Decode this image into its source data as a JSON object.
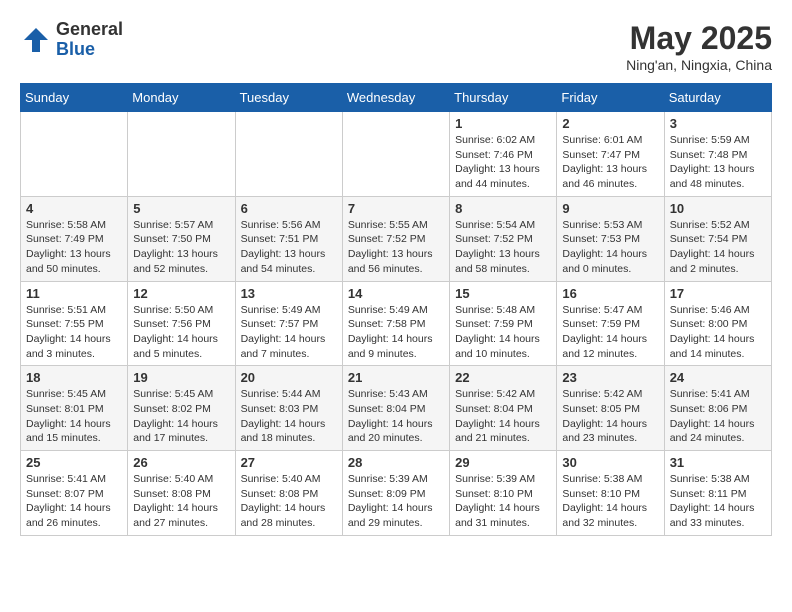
{
  "logo": {
    "general": "General",
    "blue": "Blue"
  },
  "title": "May 2025",
  "subtitle": "Ning'an, Ningxia, China",
  "days_of_week": [
    "Sunday",
    "Monday",
    "Tuesday",
    "Wednesday",
    "Thursday",
    "Friday",
    "Saturday"
  ],
  "weeks": [
    [
      {
        "day": "",
        "info": ""
      },
      {
        "day": "",
        "info": ""
      },
      {
        "day": "",
        "info": ""
      },
      {
        "day": "",
        "info": ""
      },
      {
        "day": "1",
        "info": "Sunrise: 6:02 AM\nSunset: 7:46 PM\nDaylight: 13 hours\nand 44 minutes."
      },
      {
        "day": "2",
        "info": "Sunrise: 6:01 AM\nSunset: 7:47 PM\nDaylight: 13 hours\nand 46 minutes."
      },
      {
        "day": "3",
        "info": "Sunrise: 5:59 AM\nSunset: 7:48 PM\nDaylight: 13 hours\nand 48 minutes."
      }
    ],
    [
      {
        "day": "4",
        "info": "Sunrise: 5:58 AM\nSunset: 7:49 PM\nDaylight: 13 hours\nand 50 minutes."
      },
      {
        "day": "5",
        "info": "Sunrise: 5:57 AM\nSunset: 7:50 PM\nDaylight: 13 hours\nand 52 minutes."
      },
      {
        "day": "6",
        "info": "Sunrise: 5:56 AM\nSunset: 7:51 PM\nDaylight: 13 hours\nand 54 minutes."
      },
      {
        "day": "7",
        "info": "Sunrise: 5:55 AM\nSunset: 7:52 PM\nDaylight: 13 hours\nand 56 minutes."
      },
      {
        "day": "8",
        "info": "Sunrise: 5:54 AM\nSunset: 7:52 PM\nDaylight: 13 hours\nand 58 minutes."
      },
      {
        "day": "9",
        "info": "Sunrise: 5:53 AM\nSunset: 7:53 PM\nDaylight: 14 hours\nand 0 minutes."
      },
      {
        "day": "10",
        "info": "Sunrise: 5:52 AM\nSunset: 7:54 PM\nDaylight: 14 hours\nand 2 minutes."
      }
    ],
    [
      {
        "day": "11",
        "info": "Sunrise: 5:51 AM\nSunset: 7:55 PM\nDaylight: 14 hours\nand 3 minutes."
      },
      {
        "day": "12",
        "info": "Sunrise: 5:50 AM\nSunset: 7:56 PM\nDaylight: 14 hours\nand 5 minutes."
      },
      {
        "day": "13",
        "info": "Sunrise: 5:49 AM\nSunset: 7:57 PM\nDaylight: 14 hours\nand 7 minutes."
      },
      {
        "day": "14",
        "info": "Sunrise: 5:49 AM\nSunset: 7:58 PM\nDaylight: 14 hours\nand 9 minutes."
      },
      {
        "day": "15",
        "info": "Sunrise: 5:48 AM\nSunset: 7:59 PM\nDaylight: 14 hours\nand 10 minutes."
      },
      {
        "day": "16",
        "info": "Sunrise: 5:47 AM\nSunset: 7:59 PM\nDaylight: 14 hours\nand 12 minutes."
      },
      {
        "day": "17",
        "info": "Sunrise: 5:46 AM\nSunset: 8:00 PM\nDaylight: 14 hours\nand 14 minutes."
      }
    ],
    [
      {
        "day": "18",
        "info": "Sunrise: 5:45 AM\nSunset: 8:01 PM\nDaylight: 14 hours\nand 15 minutes."
      },
      {
        "day": "19",
        "info": "Sunrise: 5:45 AM\nSunset: 8:02 PM\nDaylight: 14 hours\nand 17 minutes."
      },
      {
        "day": "20",
        "info": "Sunrise: 5:44 AM\nSunset: 8:03 PM\nDaylight: 14 hours\nand 18 minutes."
      },
      {
        "day": "21",
        "info": "Sunrise: 5:43 AM\nSunset: 8:04 PM\nDaylight: 14 hours\nand 20 minutes."
      },
      {
        "day": "22",
        "info": "Sunrise: 5:42 AM\nSunset: 8:04 PM\nDaylight: 14 hours\nand 21 minutes."
      },
      {
        "day": "23",
        "info": "Sunrise: 5:42 AM\nSunset: 8:05 PM\nDaylight: 14 hours\nand 23 minutes."
      },
      {
        "day": "24",
        "info": "Sunrise: 5:41 AM\nSunset: 8:06 PM\nDaylight: 14 hours\nand 24 minutes."
      }
    ],
    [
      {
        "day": "25",
        "info": "Sunrise: 5:41 AM\nSunset: 8:07 PM\nDaylight: 14 hours\nand 26 minutes."
      },
      {
        "day": "26",
        "info": "Sunrise: 5:40 AM\nSunset: 8:08 PM\nDaylight: 14 hours\nand 27 minutes."
      },
      {
        "day": "27",
        "info": "Sunrise: 5:40 AM\nSunset: 8:08 PM\nDaylight: 14 hours\nand 28 minutes."
      },
      {
        "day": "28",
        "info": "Sunrise: 5:39 AM\nSunset: 8:09 PM\nDaylight: 14 hours\nand 29 minutes."
      },
      {
        "day": "29",
        "info": "Sunrise: 5:39 AM\nSunset: 8:10 PM\nDaylight: 14 hours\nand 31 minutes."
      },
      {
        "day": "30",
        "info": "Sunrise: 5:38 AM\nSunset: 8:10 PM\nDaylight: 14 hours\nand 32 minutes."
      },
      {
        "day": "31",
        "info": "Sunrise: 5:38 AM\nSunset: 8:11 PM\nDaylight: 14 hours\nand 33 minutes."
      }
    ]
  ]
}
